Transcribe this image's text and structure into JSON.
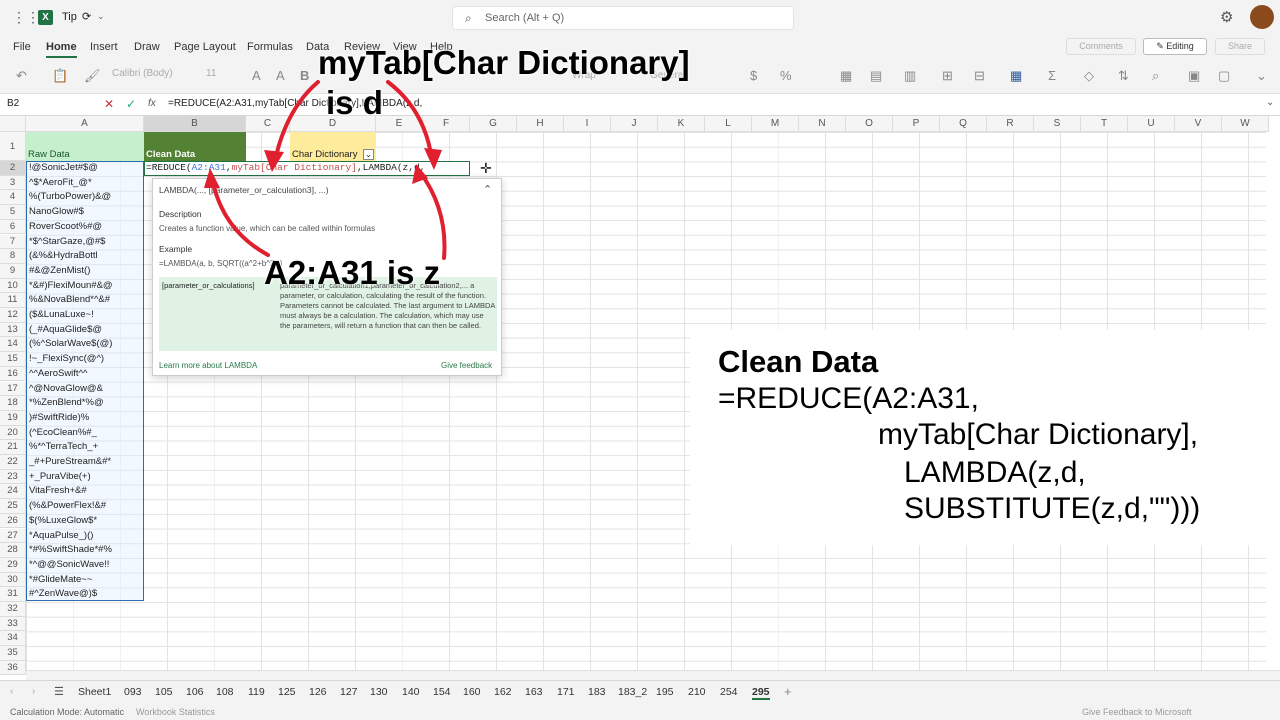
{
  "titlebar": {
    "app_name": "Tip",
    "search_placeholder": "Search (Alt + Q)"
  },
  "ribbon": {
    "tabs": [
      "File",
      "Home",
      "Insert",
      "Draw",
      "Page Layout",
      "Formulas",
      "Data",
      "Review",
      "View",
      "Help"
    ],
    "active_tab": "Home",
    "comments": "Comments",
    "editing": "Editing",
    "share": "Share",
    "font": "Calibri (Body)",
    "font_size": "11",
    "wrap": "Wrap",
    "number_format": "General"
  },
  "formula_bar": {
    "name_box": "B2",
    "fx": "fx",
    "formula": "=REDUCE(A2:A31,myTab[Char Dictionary],LAMBDA(z,d,"
  },
  "columns": [
    "A",
    "B",
    "C",
    "D",
    "E",
    "F",
    "G",
    "H",
    "I",
    "J",
    "K",
    "L",
    "M",
    "N",
    "O",
    "P",
    "Q",
    "R",
    "S",
    "T",
    "U",
    "V",
    "W"
  ],
  "headers": {
    "a1": "Raw Data",
    "b1": "Clean Data",
    "d1": "Char Dictionary"
  },
  "editing_cell": {
    "prefix": "=REDUCE(",
    "ref1": "A2:A31",
    "sep1": ",",
    "ref2": "myTab[Char Dictionary]",
    "rest": ",LAMBDA(z,d,"
  },
  "raw_data": [
    "!@SonicJet#$@",
    "^$*AeroFit_@*",
    "%(TurboPower)&@",
    "NanoGlow#$",
    "RoverScoot%#@",
    "*$^StarGaze,@#$",
    "(&%&HydraBottl",
    "#&@ZenMist()",
    "*&#)FlexiMoun#&@",
    "%&NovaBlend*^&#",
    "($&LunaLuxe~!",
    "(_#AquaGlide$@",
    "(%^SolarWave$(@)",
    "!~_FlexiSync(@^)",
    "^^AeroSwift^^",
    "^@NovaGlow@&",
    "*%ZenBlend*%@",
    ")#SwiftRide)%",
    "(^EcoClean%#_",
    "%*^TerraTech_+",
    "_#+PureStream&#*",
    "+_PuraVibe(+)",
    "VitaFresh+&#",
    "(%&PowerFlex!&#",
    "$(%LuxeGlow$*",
    "*AquaPulse_)()",
    "*#%SwiftShade*#%",
    "*^@@SonicWave!!",
    "*#GlideMate~~",
    "#^ZenWave@)$"
  ],
  "row_numbers": [
    "1",
    "2",
    "3",
    "4",
    "5",
    "6",
    "7",
    "8",
    "9",
    "10",
    "11",
    "12",
    "13",
    "14",
    "15",
    "16",
    "17",
    "18",
    "19",
    "20",
    "21",
    "22",
    "23",
    "24",
    "25",
    "26",
    "27",
    "28",
    "29",
    "30",
    "31",
    "32",
    "33",
    "34",
    "35",
    "36"
  ],
  "tooltip": {
    "signature": "LAMBDA(..., [parameter_or_calculation3], ...)",
    "desc_label": "Description",
    "desc": "Creates a function value, which can be called within formulas",
    "example_label": "Example",
    "example": "=LAMBDA(a, b, SQRT((a^2+b^2)))",
    "param_name": "[parameter_or_calculations]",
    "param_desc": "parameter_or_calculation1,parameter_or_calculation2,... a parameter, or calculation, calculating the result of the function. Parameters cannot be calculated. The last argument to LAMBDA must always be a calculation. The calculation, which may use the parameters, will return a function that can then be called.",
    "learn_more": "Learn more about LAMBDA",
    "feedback": "Give feedback"
  },
  "annotations": {
    "mytab_line1": "myTab[Char Dictionary]",
    "mytab_line2": "is d",
    "a2_is_z": "A2:A31 is z"
  },
  "overlay": {
    "title": "Clean Data",
    "line1": "=REDUCE(A2:A31,",
    "line2": "myTab[Char Dictionary],",
    "line3": "LAMBDA(z,d,",
    "line4": "SUBSTITUTE(z,d,\"\")))"
  },
  "sheets": [
    "Sheet1",
    "093",
    "105",
    "106",
    "108",
    "119",
    "125",
    "126",
    "127",
    "130",
    "140",
    "154",
    "160",
    "162",
    "163",
    "171",
    "183",
    "183_2",
    "195",
    "210",
    "254",
    "295"
  ],
  "active_sheet": "295",
  "status": {
    "mode": "Calculation Mode: Automatic",
    "stats": "Workbook Statistics",
    "feedback": "Give Feedback to Microsoft"
  },
  "colors": {
    "green": "#217346",
    "clean_header": "#548235",
    "raw_header": "#c6efce",
    "dict_header": "#ffeb9c",
    "arrow": "#e0202e"
  }
}
